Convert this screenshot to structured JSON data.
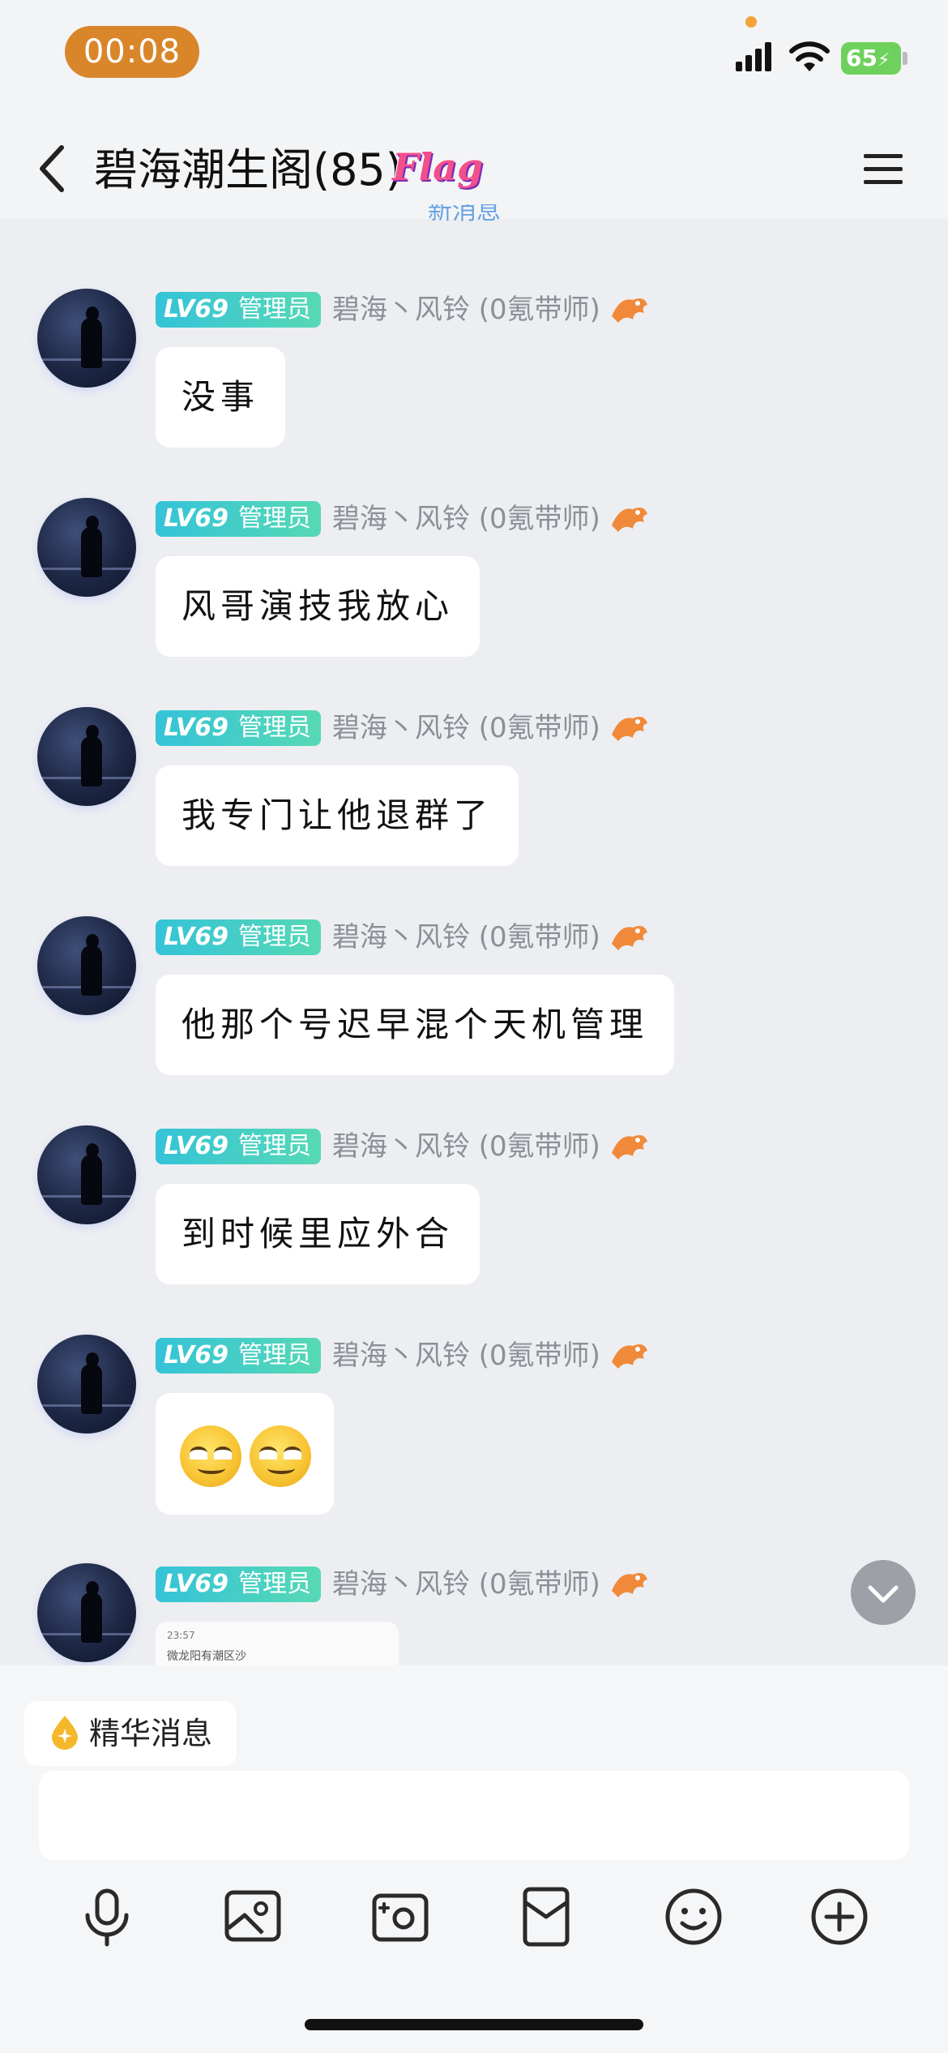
{
  "status_bar": {
    "time": "00:08",
    "battery": "65",
    "icons": [
      "signal-icon",
      "wifi-icon",
      "battery-charging-icon"
    ],
    "time_pill_color": "#d9862a",
    "battery_color": "#6fd15d"
  },
  "header": {
    "title": "碧海潮生阁(85)",
    "flag_badge": "Flag",
    "new_message_hint": "新消息",
    "back_icon": "back-chevron-icon",
    "menu_icon": "hamburger-menu-icon"
  },
  "messages": [
    {
      "level": "LV69",
      "role": "管理员",
      "sender": "碧海丶风铃 (0氪带师)",
      "text": "没事"
    },
    {
      "level": "LV69",
      "role": "管理员",
      "sender": "碧海丶风铃 (0氪带师)",
      "text": "风哥演技我放心"
    },
    {
      "level": "LV69",
      "role": "管理员",
      "sender": "碧海丶风铃 (0氪带师)",
      "text": "我专门让他退群了"
    },
    {
      "level": "LV69",
      "role": "管理员",
      "sender": "碧海丶风铃 (0氪带师)",
      "text": "他那个号迟早混个天机管理"
    },
    {
      "level": "LV69",
      "role": "管理员",
      "sender": "碧海丶风铃 (0氪带师)",
      "text": "到时候里应外合"
    },
    {
      "level": "LV69",
      "role": "管理员",
      "sender": "碧海丶风铃 (0氪带师)",
      "emoji": [
        "smirk-face-emoji",
        "smirk-face-emoji"
      ]
    },
    {
      "level": "LV69",
      "role": "管理员",
      "sender": "碧海丶风铃 (0氪带师)",
      "image_preview": {
        "top_text": "23:57",
        "title_text": "微龙阳有潮区沙"
      }
    }
  ],
  "essence": {
    "label": "精华消息",
    "icon": "essence-drop-icon"
  },
  "input": {
    "placeholder": "",
    "value": ""
  },
  "toolbar": [
    "microphone-icon",
    "image-icon",
    "camera-icon",
    "red-packet-icon",
    "emoji-icon",
    "plus-circle-icon"
  ],
  "colors": {
    "level_badge_start": "#34c3d8",
    "level_badge_end": "#57d9b4",
    "background": "#edeef2"
  }
}
